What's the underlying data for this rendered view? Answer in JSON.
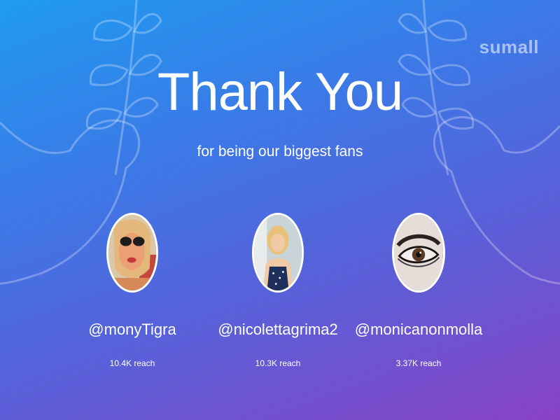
{
  "brand": {
    "logo_text": "sumall"
  },
  "header": {
    "title": "Thank You",
    "subtitle": "for being our biggest fans"
  },
  "fans": [
    {
      "handle": "@monyTigra",
      "reach": "10.4K reach"
    },
    {
      "handle": "@nicolettagrima2",
      "reach": "10.3K reach"
    },
    {
      "handle": "@monicanonmolla",
      "reach": "3.37K reach"
    }
  ],
  "colors": {
    "gradient_start": "#1f9bf0",
    "gradient_end": "#8a43c6",
    "text": "#ffffff"
  }
}
